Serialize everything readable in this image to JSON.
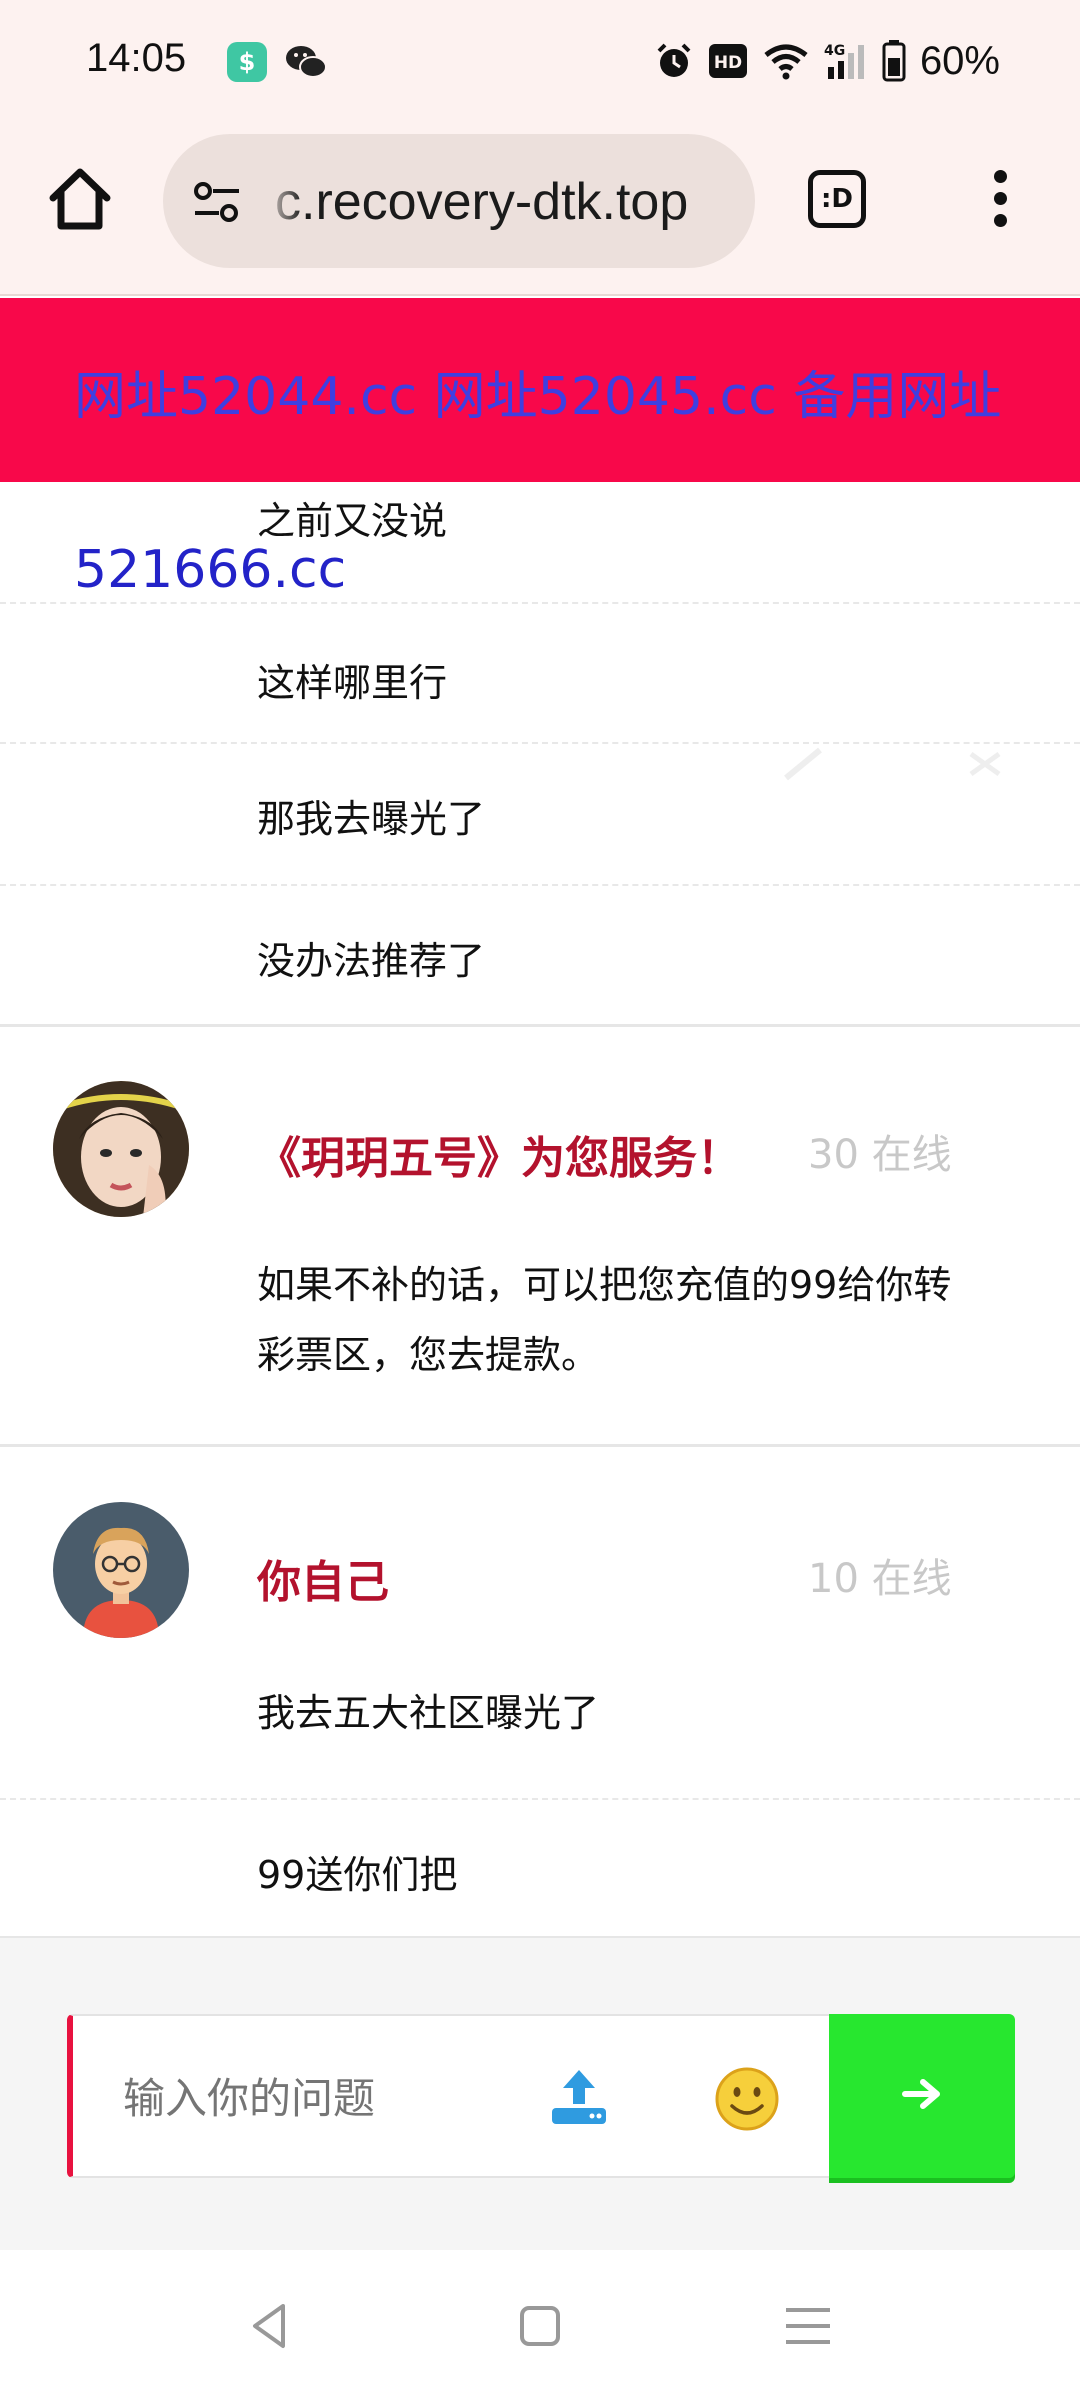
{
  "status_bar": {
    "time": "14:05",
    "battery": "60%",
    "icons": [
      "shield-app-icon",
      "wechat-icon",
      "alarm-icon",
      "hd-icon",
      "wifi-icon",
      "signal-4g-icon",
      "battery-icon"
    ],
    "hd_label": "HD",
    "net_label": "4G"
  },
  "browser": {
    "url": "c.recovery-dtk.top",
    "tab_label": ":D"
  },
  "banner": {
    "text": "网址52044.cc 网址52045.cc 备用网址",
    "extra": "521666.cc",
    "background": "#f8084a",
    "text_color": "#3f3fe0"
  },
  "messages_top": [
    "之前又没说",
    "这样哪里行",
    "那我去曝光了",
    "没办法推荐了"
  ],
  "agent": {
    "name": "《玥玥五号》为您服务！",
    "online": "30 在线",
    "message": "如果不补的话，可以把您充值的99给你转彩票区，您去提款。"
  },
  "self": {
    "name": "你自己",
    "online": "10 在线",
    "messages": [
      "我去五大社区曝光了",
      "99送你们把"
    ]
  },
  "input": {
    "placeholder": "输入你的问题",
    "accent": "#e8123f",
    "send_color": "#27e72f"
  }
}
